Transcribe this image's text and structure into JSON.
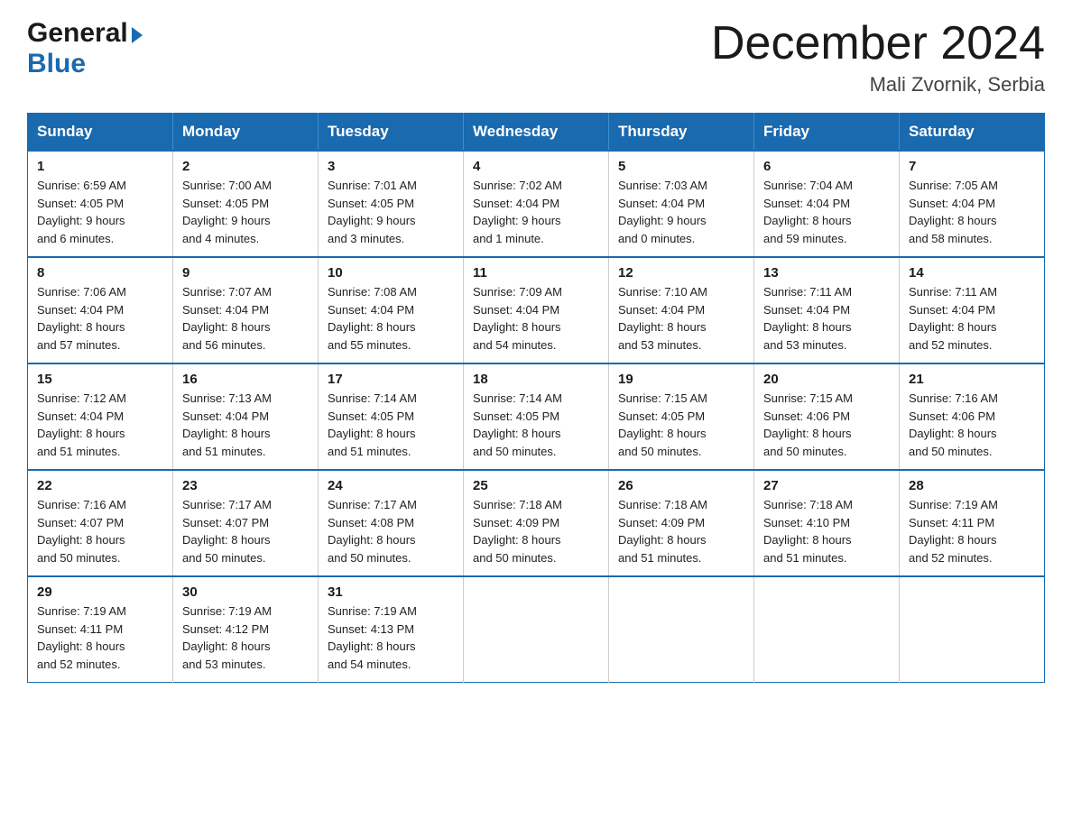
{
  "logo": {
    "general": "General",
    "triangle": "▶",
    "blue": "Blue"
  },
  "header": {
    "month": "December 2024",
    "location": "Mali Zvornik, Serbia"
  },
  "days": [
    "Sunday",
    "Monday",
    "Tuesday",
    "Wednesday",
    "Thursday",
    "Friday",
    "Saturday"
  ],
  "weeks": [
    [
      {
        "day": "1",
        "sunrise": "6:59 AM",
        "sunset": "4:05 PM",
        "daylight": "9 hours",
        "daylight2": "and 6 minutes."
      },
      {
        "day": "2",
        "sunrise": "7:00 AM",
        "sunset": "4:05 PM",
        "daylight": "9 hours",
        "daylight2": "and 4 minutes."
      },
      {
        "day": "3",
        "sunrise": "7:01 AM",
        "sunset": "4:05 PM",
        "daylight": "9 hours",
        "daylight2": "and 3 minutes."
      },
      {
        "day": "4",
        "sunrise": "7:02 AM",
        "sunset": "4:04 PM",
        "daylight": "9 hours",
        "daylight2": "and 1 minute."
      },
      {
        "day": "5",
        "sunrise": "7:03 AM",
        "sunset": "4:04 PM",
        "daylight": "9 hours",
        "daylight2": "and 0 minutes."
      },
      {
        "day": "6",
        "sunrise": "7:04 AM",
        "sunset": "4:04 PM",
        "daylight": "8 hours",
        "daylight2": "and 59 minutes."
      },
      {
        "day": "7",
        "sunrise": "7:05 AM",
        "sunset": "4:04 PM",
        "daylight": "8 hours",
        "daylight2": "and 58 minutes."
      }
    ],
    [
      {
        "day": "8",
        "sunrise": "7:06 AM",
        "sunset": "4:04 PM",
        "daylight": "8 hours",
        "daylight2": "and 57 minutes."
      },
      {
        "day": "9",
        "sunrise": "7:07 AM",
        "sunset": "4:04 PM",
        "daylight": "8 hours",
        "daylight2": "and 56 minutes."
      },
      {
        "day": "10",
        "sunrise": "7:08 AM",
        "sunset": "4:04 PM",
        "daylight": "8 hours",
        "daylight2": "and 55 minutes."
      },
      {
        "day": "11",
        "sunrise": "7:09 AM",
        "sunset": "4:04 PM",
        "daylight": "8 hours",
        "daylight2": "and 54 minutes."
      },
      {
        "day": "12",
        "sunrise": "7:10 AM",
        "sunset": "4:04 PM",
        "daylight": "8 hours",
        "daylight2": "and 53 minutes."
      },
      {
        "day": "13",
        "sunrise": "7:11 AM",
        "sunset": "4:04 PM",
        "daylight": "8 hours",
        "daylight2": "and 53 minutes."
      },
      {
        "day": "14",
        "sunrise": "7:11 AM",
        "sunset": "4:04 PM",
        "daylight": "8 hours",
        "daylight2": "and 52 minutes."
      }
    ],
    [
      {
        "day": "15",
        "sunrise": "7:12 AM",
        "sunset": "4:04 PM",
        "daylight": "8 hours",
        "daylight2": "and 51 minutes."
      },
      {
        "day": "16",
        "sunrise": "7:13 AM",
        "sunset": "4:04 PM",
        "daylight": "8 hours",
        "daylight2": "and 51 minutes."
      },
      {
        "day": "17",
        "sunrise": "7:14 AM",
        "sunset": "4:05 PM",
        "daylight": "8 hours",
        "daylight2": "and 51 minutes."
      },
      {
        "day": "18",
        "sunrise": "7:14 AM",
        "sunset": "4:05 PM",
        "daylight": "8 hours",
        "daylight2": "and 50 minutes."
      },
      {
        "day": "19",
        "sunrise": "7:15 AM",
        "sunset": "4:05 PM",
        "daylight": "8 hours",
        "daylight2": "and 50 minutes."
      },
      {
        "day": "20",
        "sunrise": "7:15 AM",
        "sunset": "4:06 PM",
        "daylight": "8 hours",
        "daylight2": "and 50 minutes."
      },
      {
        "day": "21",
        "sunrise": "7:16 AM",
        "sunset": "4:06 PM",
        "daylight": "8 hours",
        "daylight2": "and 50 minutes."
      }
    ],
    [
      {
        "day": "22",
        "sunrise": "7:16 AM",
        "sunset": "4:07 PM",
        "daylight": "8 hours",
        "daylight2": "and 50 minutes."
      },
      {
        "day": "23",
        "sunrise": "7:17 AM",
        "sunset": "4:07 PM",
        "daylight": "8 hours",
        "daylight2": "and 50 minutes."
      },
      {
        "day": "24",
        "sunrise": "7:17 AM",
        "sunset": "4:08 PM",
        "daylight": "8 hours",
        "daylight2": "and 50 minutes."
      },
      {
        "day": "25",
        "sunrise": "7:18 AM",
        "sunset": "4:09 PM",
        "daylight": "8 hours",
        "daylight2": "and 50 minutes."
      },
      {
        "day": "26",
        "sunrise": "7:18 AM",
        "sunset": "4:09 PM",
        "daylight": "8 hours",
        "daylight2": "and 51 minutes."
      },
      {
        "day": "27",
        "sunrise": "7:18 AM",
        "sunset": "4:10 PM",
        "daylight": "8 hours",
        "daylight2": "and 51 minutes."
      },
      {
        "day": "28",
        "sunrise": "7:19 AM",
        "sunset": "4:11 PM",
        "daylight": "8 hours",
        "daylight2": "and 52 minutes."
      }
    ],
    [
      {
        "day": "29",
        "sunrise": "7:19 AM",
        "sunset": "4:11 PM",
        "daylight": "8 hours",
        "daylight2": "and 52 minutes."
      },
      {
        "day": "30",
        "sunrise": "7:19 AM",
        "sunset": "4:12 PM",
        "daylight": "8 hours",
        "daylight2": "and 53 minutes."
      },
      {
        "day": "31",
        "sunrise": "7:19 AM",
        "sunset": "4:13 PM",
        "daylight": "8 hours",
        "daylight2": "and 54 minutes."
      },
      null,
      null,
      null,
      null
    ]
  ]
}
